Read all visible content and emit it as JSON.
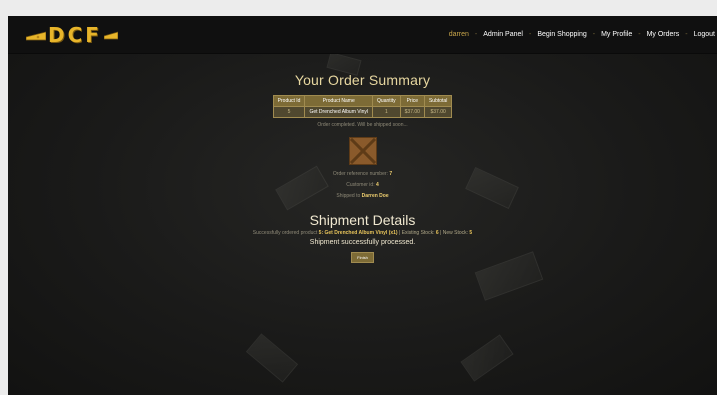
{
  "nav": {
    "brand": "DCF",
    "user": "darren",
    "items": [
      "Admin Panel",
      "Begin Shopping",
      "My Profile",
      "My Orders",
      "Logout"
    ]
  },
  "order_summary": {
    "title": "Your Order Summary",
    "columns": [
      "Product Id",
      "Product Name",
      "Quantity",
      "Price",
      "Subtotal"
    ],
    "rows": [
      [
        "5",
        "Get Drenched Album Vinyl",
        "1",
        "$37.00",
        "$37.00"
      ]
    ],
    "note": "Order completed. Will be shipped soon...",
    "reference_label": "Order reference number:",
    "reference_value": "7",
    "customer_label": "Customer id:",
    "customer_value": "4",
    "shipped_label": "Shipped to",
    "shipped_value": "Darren Doe"
  },
  "shipment": {
    "title": "Shipment Details",
    "ordered_label": "Successfully ordered product",
    "ordered_product": "5: Get Drenched Album Vinyl",
    "ordered_qty": "(x1)",
    "existing_label": "| Existing Stock:",
    "existing_value": "6",
    "new_label": "| New Stock:",
    "new_value": "5",
    "success": "Shipment successfully processed.",
    "finish_label": "Finish"
  },
  "colors": {
    "accent": "#e8b52a",
    "table_header": "#7d6b36",
    "background": "#1a1a19"
  }
}
